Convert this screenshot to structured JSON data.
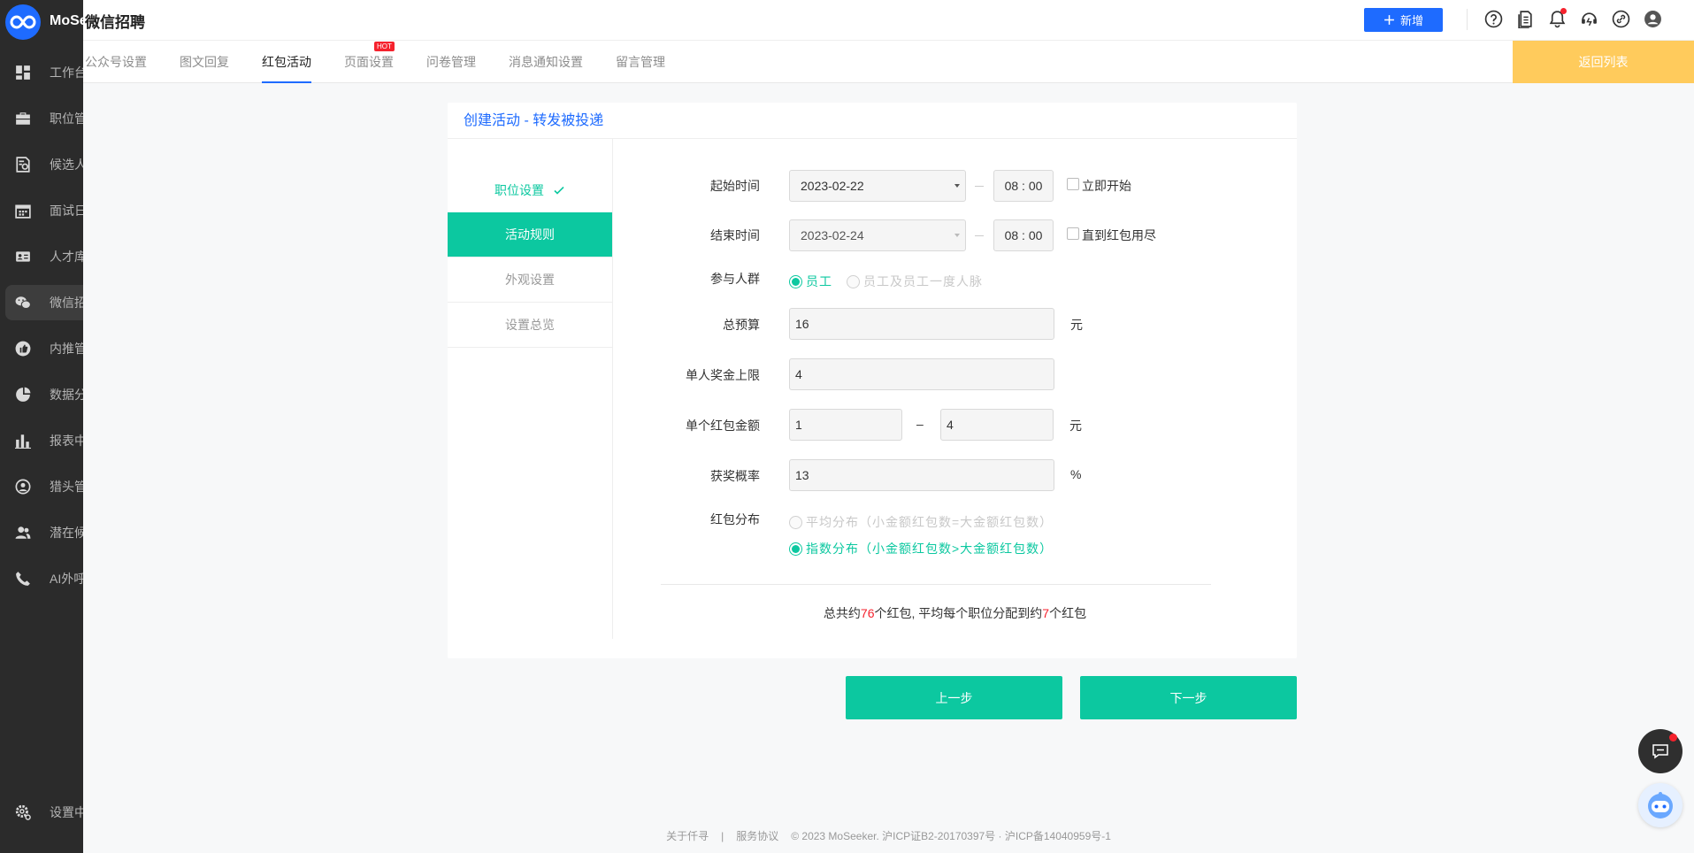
{
  "brand": {
    "logo_text": "MoSeeker",
    "app_title": "微信招聘"
  },
  "sidebar": {
    "items": [
      {
        "label": "工作台",
        "icon": "dashboard-icon"
      },
      {
        "label": "职位管理",
        "icon": "briefcase-icon"
      },
      {
        "label": "候选人",
        "icon": "candidate-doc-icon"
      },
      {
        "label": "面试日程",
        "icon": "calendar-icon"
      },
      {
        "label": "人才库",
        "icon": "id-card-icon"
      },
      {
        "label": "微信招聘",
        "icon": "wechat-icon",
        "active": true
      },
      {
        "label": "内推管理",
        "icon": "thumbs-up-icon"
      },
      {
        "label": "数据分析",
        "icon": "pie-chart-icon"
      },
      {
        "label": "报表中心",
        "icon": "bar-chart-icon"
      },
      {
        "label": "猎头管理",
        "icon": "headhunter-icon"
      },
      {
        "label": "潜在候选人",
        "icon": "users-icon"
      },
      {
        "label": "AI外呼",
        "icon": "phone-icon"
      },
      {
        "label": "设置中心",
        "icon": "settings-icon"
      }
    ]
  },
  "header": {
    "new_button": "新增",
    "new_icon": "plus-icon"
  },
  "tabs": [
    {
      "label": "公众号设置"
    },
    {
      "label": "图文回复"
    },
    {
      "label": "红包活动",
      "active": true
    },
    {
      "label": "页面设置",
      "badge": "HOT"
    },
    {
      "label": "问卷管理"
    },
    {
      "label": "消息通知设置"
    },
    {
      "label": "留言管理"
    }
  ],
  "back_button": "返回列表",
  "card": {
    "title": "创建活动 - 转发被投递"
  },
  "steps": [
    {
      "label": "职位设置",
      "state": "done"
    },
    {
      "label": "活动规则",
      "state": "current"
    },
    {
      "label": "外观设置",
      "state": "pending"
    },
    {
      "label": "设置总览",
      "state": "pending"
    }
  ],
  "form": {
    "start_time": {
      "label": "起始时间",
      "date": "2023-02-22",
      "time": "08 : 00",
      "checkbox": "立即开始"
    },
    "end_time": {
      "label": "结束时间",
      "date": "2023-02-24",
      "time": "08 : 00",
      "checkbox": "直到红包用尽"
    },
    "audience": {
      "label": "参与人群",
      "options": [
        "员工",
        "员工及员工一度人脉"
      ],
      "selected": 0
    },
    "budget": {
      "label": "总预算",
      "value": "16",
      "unit": "元"
    },
    "per_person_limit": {
      "label": "单人奖金上限",
      "value": "4"
    },
    "packet_amount": {
      "label": "单个红包金额",
      "min": "1",
      "sep": "–",
      "max": "4",
      "unit": "元"
    },
    "win_rate": {
      "label": "获奖概率",
      "value": "13",
      "unit": "%"
    },
    "distribution": {
      "label": "红包分布",
      "options": [
        "平均分布（小金额红包数=大金额红包数）",
        "指数分布（小金额红包数>大金额红包数）"
      ],
      "selected": 1
    }
  },
  "summary": {
    "prefix": "总共约",
    "total": "76",
    "middle": "个红包, 平均每个职位分配到约",
    "per_job": "7",
    "suffix": "个红包"
  },
  "buttons": {
    "prev": "上一步",
    "next": "下一步"
  },
  "footer": {
    "about": "关于仟寻",
    "divider": "|",
    "terms": "服务协议",
    "copyright": "© 2023 MoSeeker. 沪ICP证B2-20170397号 · 沪ICP备14040959号-1"
  },
  "colors": {
    "primary": "#1e6bff",
    "accent": "#0cc8a0",
    "warning": "#ffcb5c",
    "sidebar": "#2b2b2b",
    "highlight": "#f5222d"
  }
}
